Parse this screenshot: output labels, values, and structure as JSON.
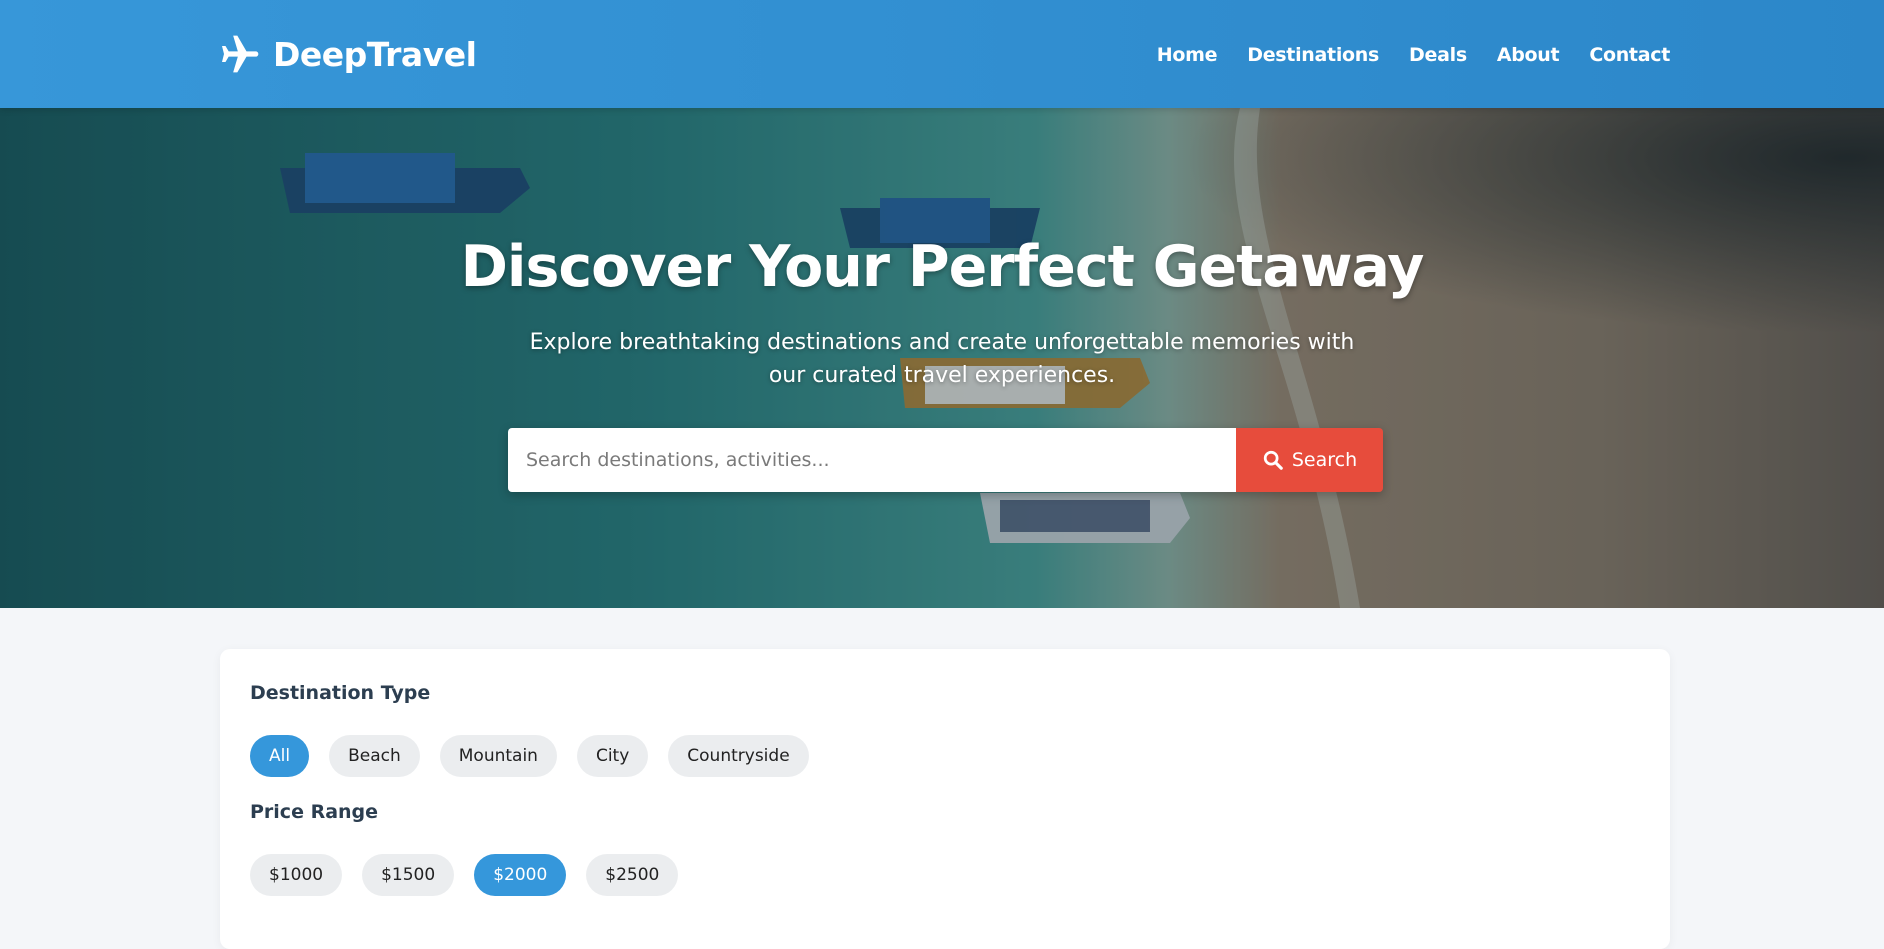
{
  "brand": {
    "name": "DeepTravel",
    "icon": "airplane-icon"
  },
  "nav": {
    "items": [
      {
        "label": "Home"
      },
      {
        "label": "Destinations"
      },
      {
        "label": "Deals"
      },
      {
        "label": "About"
      },
      {
        "label": "Contact"
      }
    ]
  },
  "hero": {
    "title": "Discover Your Perfect Getaway",
    "subtitle": "Explore breathtaking destinations and create unforgettable memories with our curated travel experiences.",
    "search": {
      "placeholder": "Search destinations, activities...",
      "value": "",
      "button_label": "Search",
      "button_icon": "search-icon"
    }
  },
  "filters": {
    "destination_type": {
      "label": "Destination Type",
      "options": [
        "All",
        "Beach",
        "Mountain",
        "City",
        "Countryside"
      ],
      "selected": "All"
    },
    "price_range": {
      "label": "Price Range",
      "options": [
        "$1000",
        "$1500",
        "$2000",
        "$2500"
      ],
      "selected": "$2000"
    }
  },
  "colors": {
    "header": "#3193d5",
    "accent": "#3597db",
    "search_button": "#e74c3c",
    "heading_text": "#2c3e50"
  }
}
